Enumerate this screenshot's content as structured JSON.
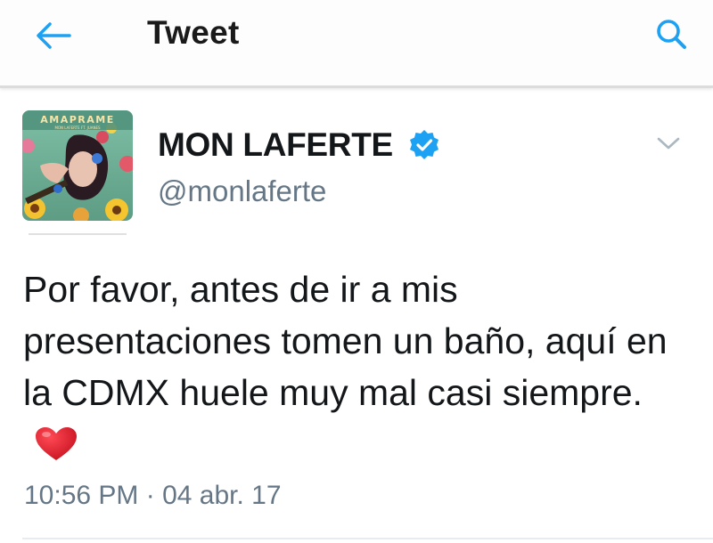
{
  "header": {
    "back_icon": "back-arrow-icon",
    "title": "Tweet",
    "search_icon": "search-icon",
    "accent_color": "#1da1f2"
  },
  "tweet": {
    "avatar": {
      "banner_text": "AMAPRAME",
      "small_text": "MON LAFERTE FT. JUANES"
    },
    "display_name": "MON LAFERTE",
    "verified": true,
    "verified_icon": "verified-badge-icon",
    "handle": "@monlaferte",
    "menu_icon": "chevron-down-icon",
    "text": "Por favor, antes de ir a mis presentaciones tomen un baño, aquí en la CDMX huele muy mal casi siempre.",
    "emoji_icon": "red-heart-icon",
    "timestamp": "10:56 PM · 04 abr. 17"
  }
}
